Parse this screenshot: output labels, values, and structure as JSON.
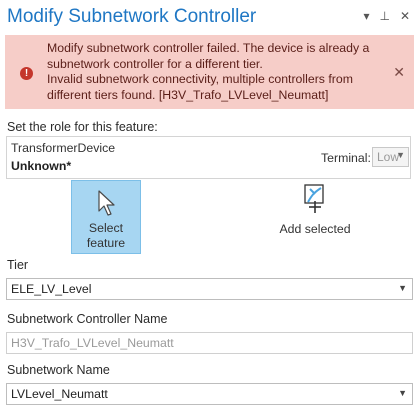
{
  "window": {
    "title": "Modify Subnetwork Controller",
    "icons": [
      "chevron-down-icon",
      "pin-icon",
      "close-icon"
    ]
  },
  "error": {
    "lines": [
      "Modify subnetwork controller failed.  The device is already a",
      "subnetwork controller for a different tier.",
      "Invalid subnetwork connectivity, multiple controllers from",
      "different tiers found. [H3V_Trafo_LVLevel_Neumatt]"
    ],
    "icon": "!",
    "close": "✕"
  },
  "role": {
    "label": "Set the role for this feature:",
    "device_type": "TransformerDevice",
    "device_name": "Unknown*",
    "terminal_label": "Terminal:",
    "terminal_value": "Low"
  },
  "actions": {
    "select_label_1": "Select",
    "select_label_2": "feature",
    "add_label": "Add selected"
  },
  "tier": {
    "label": "Tier",
    "value": "ELE_LV_Level"
  },
  "controller_name": {
    "label": "Subnetwork Controller Name",
    "placeholder": "H3V_Trafo_LVLevel_Neumatt"
  },
  "subnetwork_name": {
    "label": "Subnetwork Name",
    "value": "LVLevel_Neumatt"
  },
  "colors": {
    "title": "#1f77c4",
    "error_bg": "#f6cdc8",
    "error_icon": "#c4362c",
    "selected_tool": "#a7d6f2"
  }
}
